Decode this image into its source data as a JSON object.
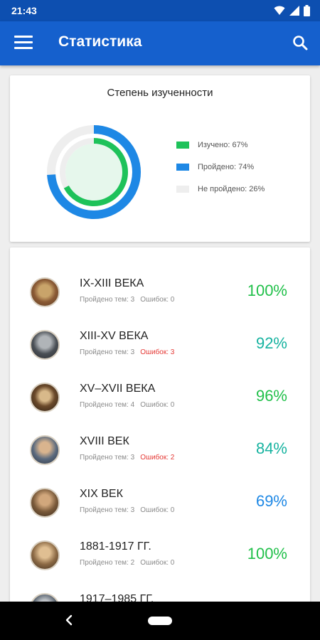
{
  "status_bar": {
    "time": "21:43"
  },
  "app_bar": {
    "title": "Статистика"
  },
  "stats": {
    "title": "Степень изученности",
    "legend": [
      {
        "label": "Изучено: 67%",
        "color": "#1ec25a"
      },
      {
        "label": "Пройдено: 74%",
        "color": "#1e88e5"
      },
      {
        "label": "Не пройдено: 26%",
        "color": "#eeeeee"
      }
    ],
    "chart_data": {
      "type": "donut",
      "series": [
        {
          "name": "Изучено",
          "value": 67,
          "color": "#1ec25a"
        },
        {
          "name": "Пройдено",
          "value": 74,
          "color": "#1e88e5"
        },
        {
          "name": "Не пройдено",
          "value": 26,
          "color": "#eeeeee"
        }
      ]
    }
  },
  "periods": [
    {
      "title": "IX-XIII ВЕКА",
      "passed": "Пройдено тем: 3",
      "errors": "Ошибок: 0",
      "errors_red": false,
      "percent": "100%",
      "percent_color": "#21c04a"
    },
    {
      "title": "XIII-XV ВЕКА",
      "passed": "Пройдено тем: 3",
      "errors": "Ошибок: 3",
      "errors_red": true,
      "percent": "92%",
      "percent_color": "#17b3a0"
    },
    {
      "title": "XV–XVII ВЕКА",
      "passed": "Пройдено тем: 4",
      "errors": "Ошибок: 0",
      "errors_red": false,
      "percent": "96%",
      "percent_color": "#21c04a"
    },
    {
      "title": "XVIII ВЕК",
      "passed": "Пройдено тем: 3",
      "errors": "Ошибок: 2",
      "errors_red": true,
      "percent": "84%",
      "percent_color": "#17b3a0"
    },
    {
      "title": "XIX ВЕК",
      "passed": "Пройдено тем: 3",
      "errors": "Ошибок: 0",
      "errors_red": false,
      "percent": "69%",
      "percent_color": "#1e88e5"
    },
    {
      "title": "1881-1917 ГГ.",
      "passed": "Пройдено тем: 2",
      "errors": "Ошибок: 0",
      "errors_red": false,
      "percent": "100%",
      "percent_color": "#21c04a"
    },
    {
      "title": "1917–1985 ГГ.",
      "passed": "",
      "errors": "",
      "errors_red": false,
      "percent": "",
      "percent_color": "#21c04a"
    }
  ],
  "icons": {
    "menu": "menu-icon",
    "search": "search-icon",
    "back": "back-icon",
    "home": "home-icon"
  }
}
